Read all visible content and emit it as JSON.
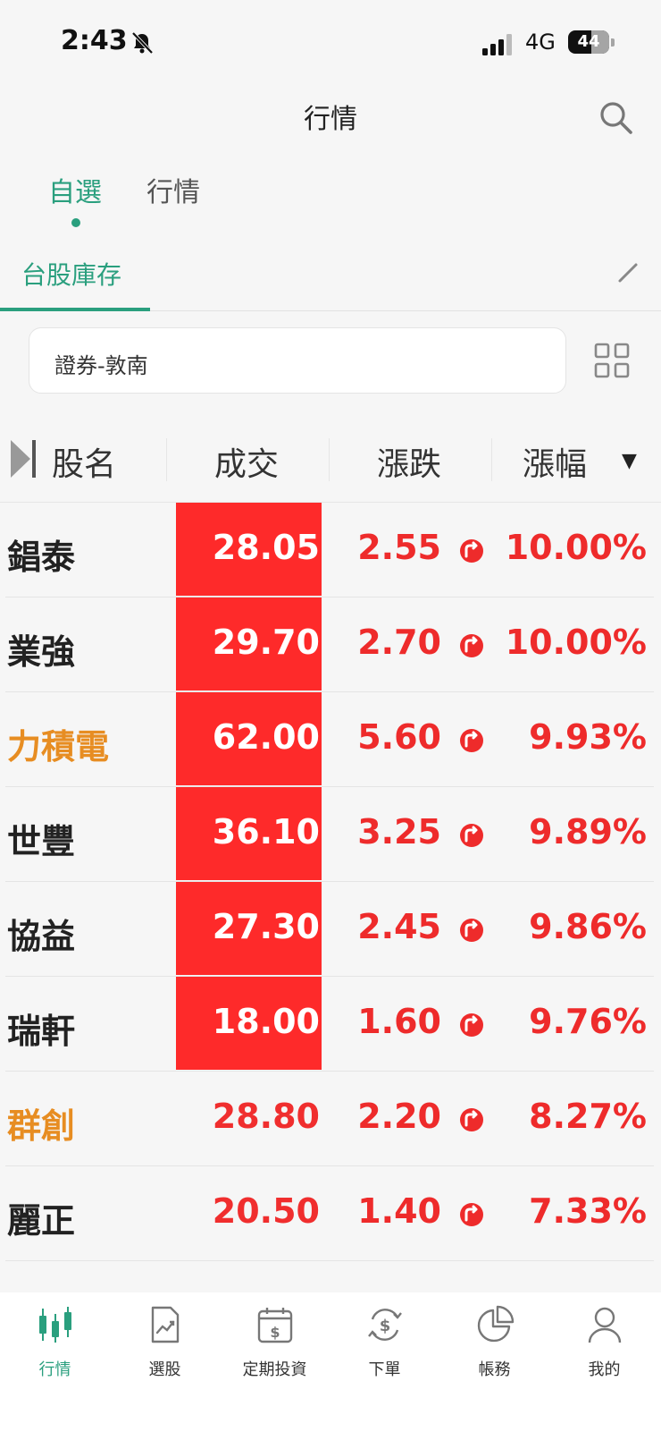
{
  "status_bar": {
    "time": "2:43",
    "network": "4G",
    "battery": "44"
  },
  "header": {
    "title": "行情"
  },
  "main_tabs": [
    {
      "label": "自選"
    },
    {
      "label": "行情"
    }
  ],
  "sub_tabs": [
    {
      "label": "台股庫存"
    }
  ],
  "account": {
    "label": "證券-敦南"
  },
  "table": {
    "columns": {
      "name": "股名",
      "price": "成交",
      "change": "漲跌",
      "pct": "漲幅"
    },
    "rows": [
      {
        "name": "錩泰",
        "price": "28.05",
        "change": "2.55",
        "pct": "10.00%",
        "limit_up": true,
        "name_color": "default"
      },
      {
        "name": "業強",
        "price": "29.70",
        "change": "2.70",
        "pct": "10.00%",
        "limit_up": true,
        "name_color": "default"
      },
      {
        "name": "力積電",
        "price": "62.00",
        "change": "5.60",
        "pct": "9.93%",
        "limit_up": true,
        "name_color": "orange"
      },
      {
        "name": "世豐",
        "price": "36.10",
        "change": "3.25",
        "pct": "9.89%",
        "limit_up": true,
        "name_color": "default"
      },
      {
        "name": "協益",
        "price": "27.30",
        "change": "2.45",
        "pct": "9.86%",
        "limit_up": true,
        "name_color": "default"
      },
      {
        "name": "瑞軒",
        "price": "18.00",
        "change": "1.60",
        "pct": "9.76%",
        "limit_up": true,
        "name_color": "default"
      },
      {
        "name": "群創",
        "price": "28.80",
        "change": "2.20",
        "pct": "8.27%",
        "limit_up": false,
        "name_color": "orange"
      },
      {
        "name": "麗正",
        "price": "20.50",
        "change": "1.40",
        "pct": "7.33%",
        "limit_up": false,
        "name_color": "default"
      }
    ]
  },
  "bottom_nav": [
    {
      "label": "行情",
      "icon": "candlestick-icon",
      "active": true
    },
    {
      "label": "選股",
      "icon": "chart-doc-icon",
      "active": false
    },
    {
      "label": "定期投資",
      "icon": "calendar-dollar-icon",
      "active": false
    },
    {
      "label": "下單",
      "icon": "dollar-cycle-icon",
      "active": false
    },
    {
      "label": "帳務",
      "icon": "pie-chart-icon",
      "active": false
    },
    {
      "label": "我的",
      "icon": "person-icon",
      "active": false
    }
  ],
  "colors": {
    "accent": "#2a9f7e",
    "up": "#ee2b2b",
    "limit_bg": "#fe2a2a",
    "highlight_name": "#e78d22"
  }
}
